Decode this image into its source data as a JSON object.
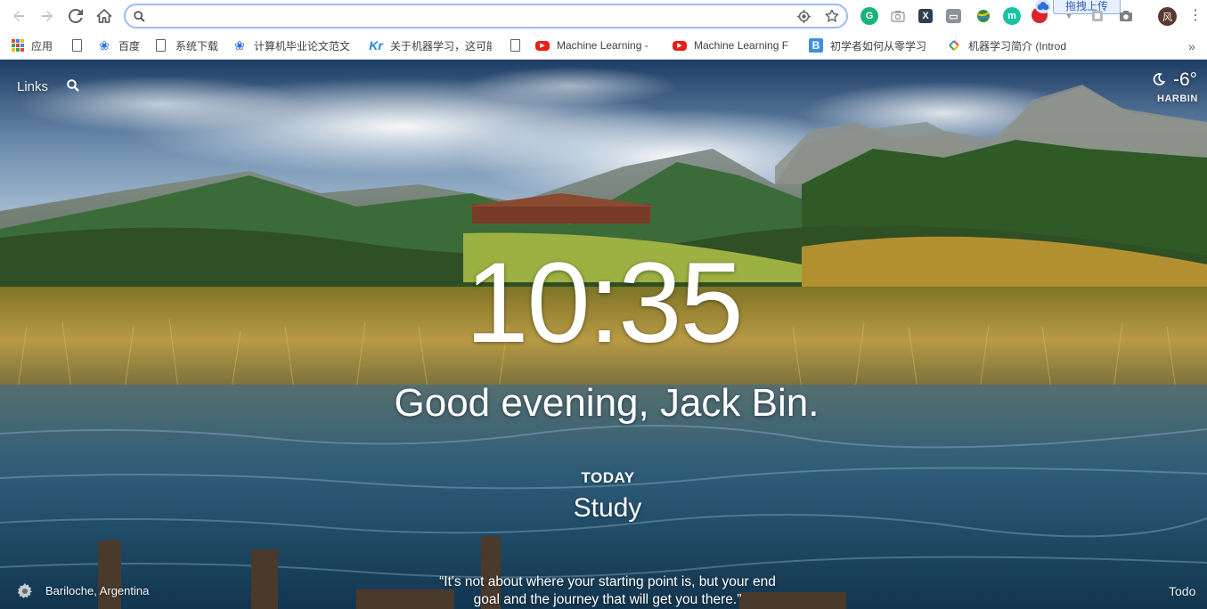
{
  "browser": {
    "omnibox": {
      "value": "",
      "placeholder": ""
    },
    "upload_tooltip": "拖拽上传",
    "avatar_text": "风",
    "bookmarks": [
      {
        "label": "应用",
        "icon": "apps-grid-icon"
      },
      {
        "label": "",
        "icon": "page-icon"
      },
      {
        "label": "百度",
        "icon": "baidu-paw-icon"
      },
      {
        "label": "系统下载",
        "icon": "page-icon"
      },
      {
        "label": "计算机毕业论文范文",
        "icon": "baidu-paw-icon"
      },
      {
        "label": "关于机器学习，这可能",
        "icon": "kr-icon"
      },
      {
        "label": "",
        "icon": "page-icon"
      },
      {
        "label": "Machine Learning -",
        "icon": "youtube-icon"
      },
      {
        "label": "Machine Learning F",
        "icon": "youtube-icon"
      },
      {
        "label": "初学者如何从零学习",
        "icon": "b-icon"
      },
      {
        "label": "机器学习简介 (Introd",
        "icon": "google-icon"
      }
    ]
  },
  "dashboard": {
    "links_label": "Links",
    "weather": {
      "temperature": "-6°",
      "location": "HARBIN",
      "icon": "moon-icon"
    },
    "clock": "10:35",
    "greeting": "Good evening, Jack Bin.",
    "focus_label": "TODAY",
    "focus_task": "Study",
    "photo_location": "Bariloche, Argentina",
    "quote": "“It's not about where your starting point is, but your end goal and the journey that will get you there.”",
    "todo_label": "Todo"
  }
}
